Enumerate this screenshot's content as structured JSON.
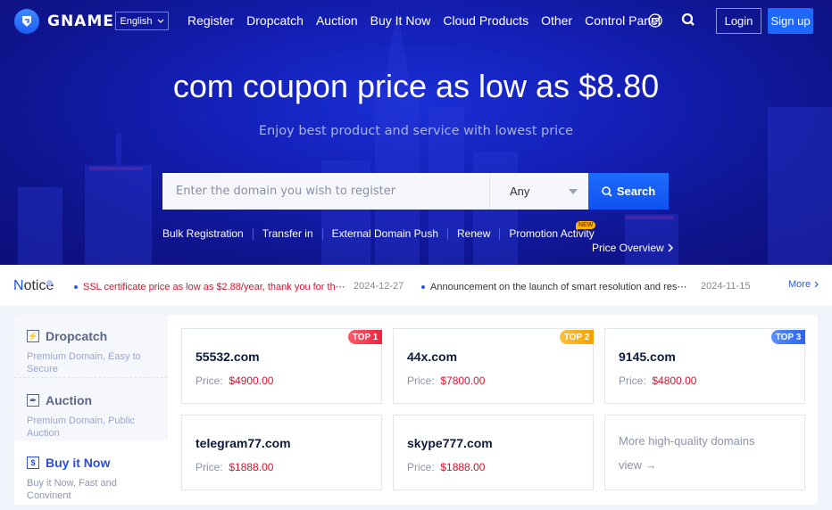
{
  "nav": {
    "brand": "GNAME",
    "language": "English",
    "menu": [
      "Register",
      "Dropcatch",
      "Auction",
      "Buy It Now",
      "Cloud Products",
      "Other",
      "Control Panel"
    ],
    "icons": [
      "cart-icon",
      "search-icon"
    ],
    "login_label": "Login",
    "signup_label": "Sign up"
  },
  "hero": {
    "headline": "com coupon price as low as $8.80",
    "subline": "Enjoy best product and service with lowest price",
    "search": {
      "placeholder": "Enter the domain you wish to register",
      "value": "",
      "suffix_selected": "Any",
      "button_label": "Search"
    },
    "quick_links": [
      "Bulk Registration",
      "Transfer in",
      "External Domain Push",
      "Renew",
      "Promotion Activity"
    ],
    "new_badge": "NEW",
    "price_overview": "Price Overview"
  },
  "notice": {
    "title_first": "N",
    "title_rest": "otice",
    "items": [
      {
        "text": "SSL certificate price as low as $2.88/year, thank you for th⋯",
        "date": "2024-12-27",
        "highlight_color": "#e0102b"
      },
      {
        "text": "Announcement on the launch of smart resolution and res⋯",
        "date": "2024-11-15"
      }
    ],
    "more_label": "More"
  },
  "market": {
    "categories": [
      {
        "title": "Dropcatch",
        "desc": "Premium Domain, Easy to Secure",
        "icon": "dropcatch-icon",
        "active": false
      },
      {
        "title": "Auction",
        "desc": "Premium Domain, Public Auction",
        "icon": "auction-gavel-icon",
        "active": false
      },
      {
        "title": "Buy it Now",
        "desc": "Buy it Now, Fast and Convinent",
        "icon": "dollar-icon",
        "active": true
      }
    ],
    "price_label": "Price:",
    "listings": [
      {
        "domain": "55532.com",
        "price": "$4900.00",
        "tag": "TOP 1"
      },
      {
        "domain": "44x.com",
        "price": "$7800.00",
        "tag": "TOP 2"
      },
      {
        "domain": "9145.com",
        "price": "$4800.00",
        "tag": "TOP 3"
      },
      {
        "domain": "telegram77.com",
        "price": "$1888.00"
      },
      {
        "domain": "skype777.com",
        "price": "$1888.00"
      }
    ],
    "more": {
      "title": "More high-quality domains",
      "view_label": "view →"
    }
  },
  "colors": {
    "brand_blue": "#1f68ff",
    "hero_bg": "#1420b8",
    "price_red": "#e0102b",
    "active_blue": "#2a4ee0"
  }
}
